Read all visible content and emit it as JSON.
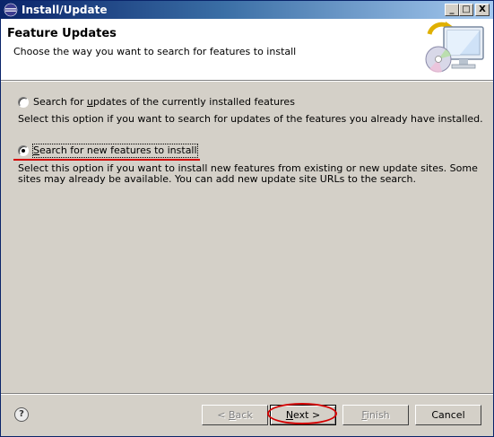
{
  "window": {
    "title": "Install/Update"
  },
  "title_buttons": {
    "minimize": "_",
    "maximize": "□",
    "close": "X"
  },
  "header": {
    "title": "Feature Updates",
    "description": "Choose the way you want to search for features to install"
  },
  "options": [
    {
      "label_pre": "Search for ",
      "label_mnemonic": "u",
      "label_post": "pdates of the currently installed features",
      "selected": false,
      "description_lines": [
        "Select this option if you want to search for updates of the features you already have installed."
      ]
    },
    {
      "label_pre": "",
      "label_mnemonic": "S",
      "label_post": "earch for new features to install",
      "selected": true,
      "description_lines": [
        "Select this option if you want to install new features from existing or new update sites. Some",
        "sites may already be available. You can add new update site URLs to the search."
      ]
    }
  ],
  "footer": {
    "help": "?",
    "back": {
      "pre": "< ",
      "mn": "B",
      "post": "ack"
    },
    "next": {
      "pre": "",
      "mn": "N",
      "post": "ext >"
    },
    "finish": {
      "pre": "",
      "mn": "F",
      "post": "inish"
    },
    "cancel": "Cancel"
  },
  "colors": {
    "annotation_red": "#d40000",
    "title_blue": "#0a246a"
  },
  "icons": [
    "eclipse-logo-icon",
    "monitor-cd-update-icon",
    "help-icon"
  ]
}
